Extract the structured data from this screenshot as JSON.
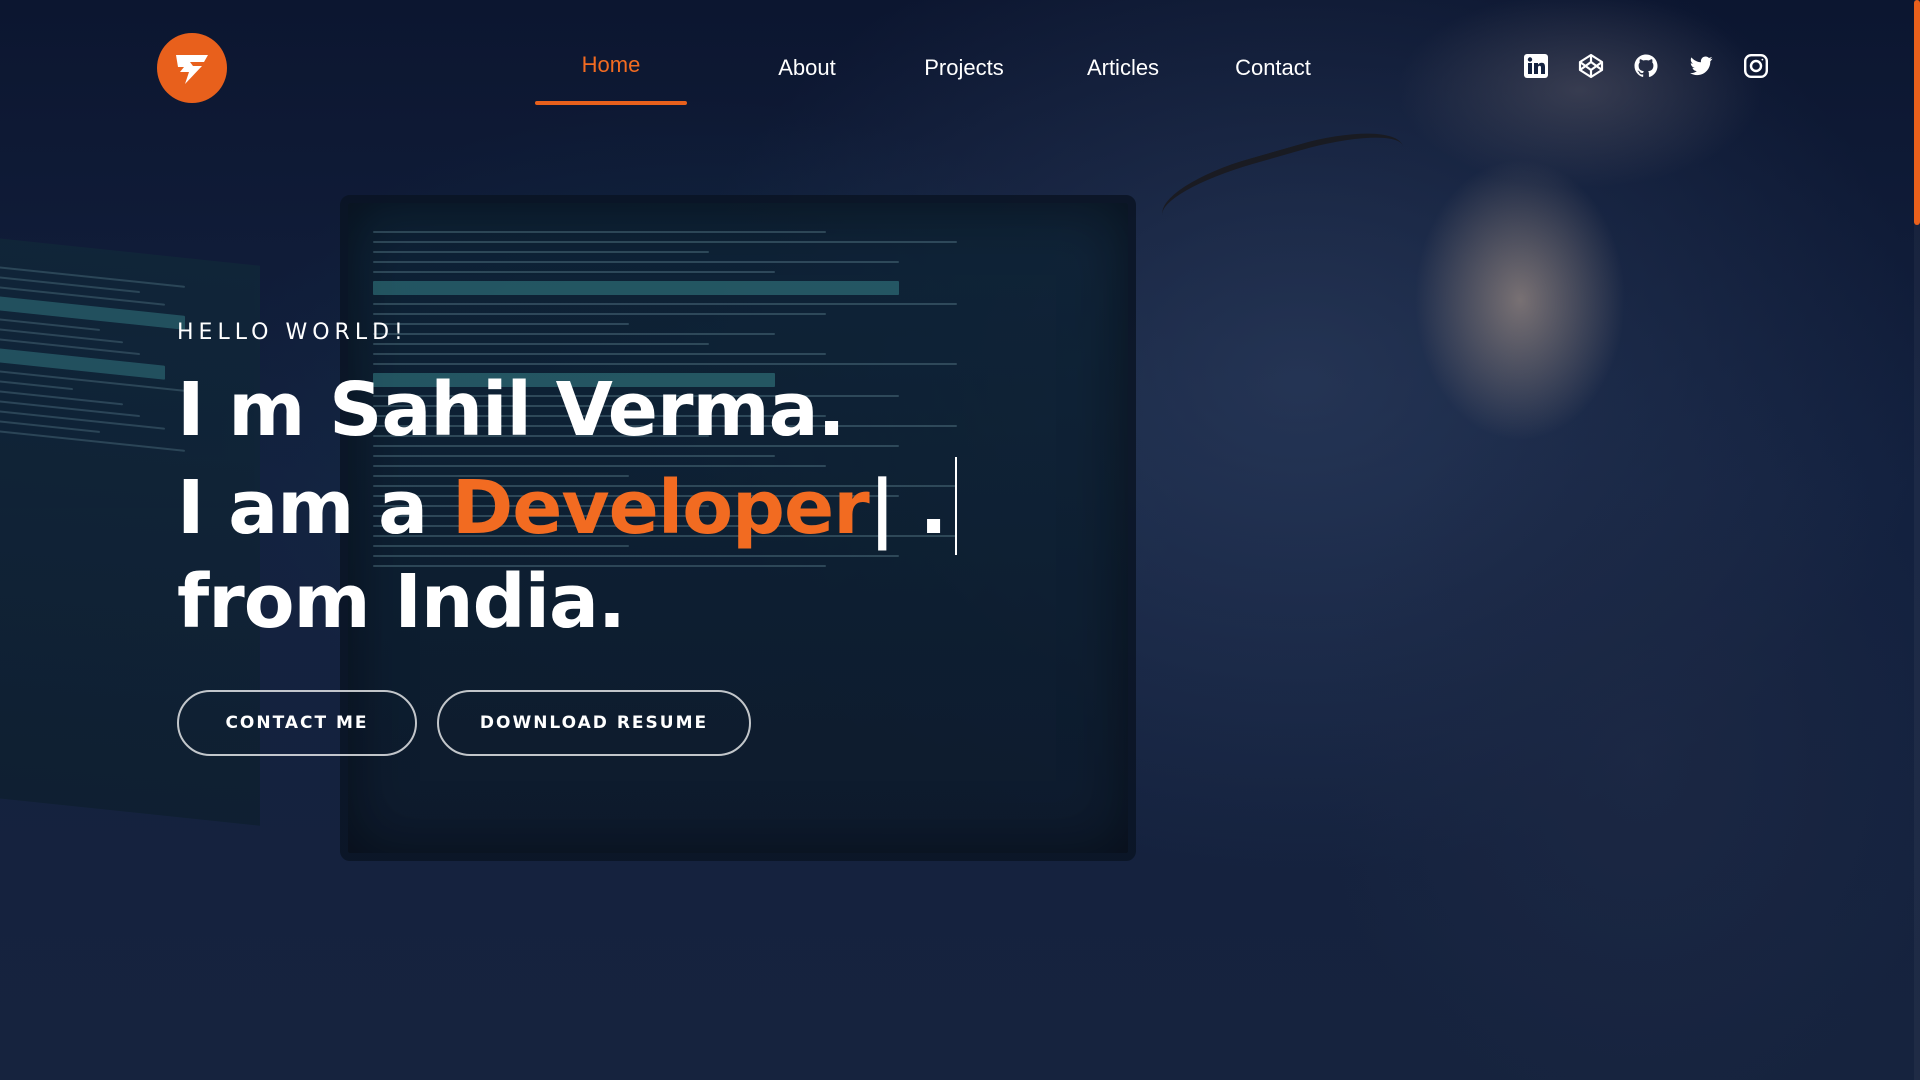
{
  "colors": {
    "accent": "#e8601c",
    "accent_text": "#f26b21",
    "background": "#0f1a33",
    "text": "#ffffff"
  },
  "header": {
    "logo_icon": "logo-icon",
    "nav": [
      {
        "label": "Home",
        "active": true
      },
      {
        "label": "About",
        "active": false
      },
      {
        "label": "Projects",
        "active": false
      },
      {
        "label": "Articles",
        "active": false
      },
      {
        "label": "Contact",
        "active": false
      }
    ],
    "socials": [
      {
        "icon": "linkedin-icon"
      },
      {
        "icon": "codepen-icon"
      },
      {
        "icon": "github-icon"
      },
      {
        "icon": "twitter-icon"
      },
      {
        "icon": "instagram-icon"
      }
    ]
  },
  "hero": {
    "greeting": "HELLO WORLD!",
    "line1": "I m Sahil Verma.",
    "line2_prefix": "I am a ",
    "role": "Developer",
    "typing_cursor": "|",
    "line2_suffix": " .",
    "line3": "from India."
  },
  "buttons": {
    "contact": "CONTACT ME",
    "resume": "DOWNLOAD RESUME"
  }
}
